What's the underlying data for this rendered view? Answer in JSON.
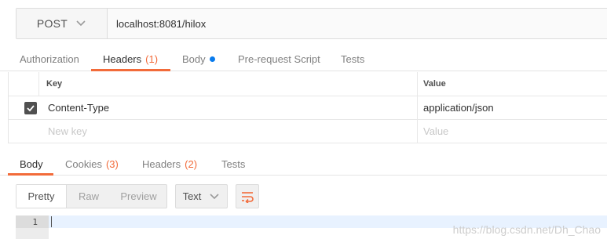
{
  "request": {
    "method": "POST",
    "url": "localhost:8081/hilox"
  },
  "request_tabs": {
    "authorization": "Authorization",
    "headers": "Headers",
    "headers_count": "(1)",
    "body": "Body",
    "prerequest": "Pre-request Script",
    "tests": "Tests"
  },
  "headers_table": {
    "key_header": "Key",
    "value_header": "Value",
    "rows": [
      {
        "checked": true,
        "key": "Content-Type",
        "value": "application/json"
      }
    ],
    "new_key_placeholder": "New key",
    "new_value_placeholder": "Value"
  },
  "response_tabs": {
    "body": "Body",
    "cookies": "Cookies",
    "cookies_count": "(3)",
    "headers": "Headers",
    "headers_count": "(2)",
    "tests": "Tests"
  },
  "response_toolbar": {
    "pretty": "Pretty",
    "raw": "Raw",
    "preview": "Preview",
    "format": "Text"
  },
  "editor": {
    "line_number": "1"
  },
  "watermark": "https://blog.csdn.net/Dh_Chao",
  "colors": {
    "accent": "#f26b3a",
    "blue": "#097bed"
  },
  "icons": {
    "method_dropdown": "chevron-down-icon",
    "format_dropdown": "chevron-down-icon",
    "wrap": "wrap-lines-icon",
    "checkbox": "check-icon"
  }
}
